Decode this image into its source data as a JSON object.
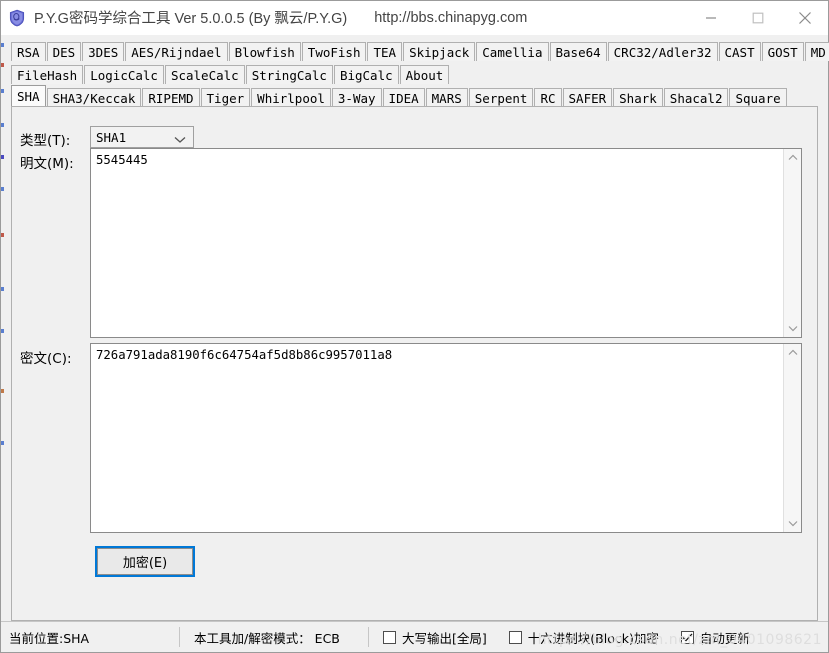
{
  "window": {
    "icon": "shield-app-icon",
    "title": "P.Y.G密码学综合工具 Ver 5.0.0.5 (By 飘云/P.Y.G)",
    "url": "http://bbs.chinapyg.com",
    "controls": {
      "minimize": "minimize-icon",
      "maximize": "maximize-icon",
      "close": "close-icon"
    }
  },
  "tabs": {
    "row1": [
      {
        "label": "RSA"
      },
      {
        "label": "DES"
      },
      {
        "label": "3DES"
      },
      {
        "label": "AES/Rijndael"
      },
      {
        "label": "Blowfish"
      },
      {
        "label": "TwoFish"
      },
      {
        "label": "TEA"
      },
      {
        "label": "Skipjack"
      },
      {
        "label": "Camellia"
      },
      {
        "label": "Base64"
      },
      {
        "label": "CRC32/Adler32"
      },
      {
        "label": "CAST"
      },
      {
        "label": "GOST"
      },
      {
        "label": "MD"
      }
    ],
    "row2": [
      {
        "label": "FileHash"
      },
      {
        "label": "LogicCalc"
      },
      {
        "label": "ScaleCalc"
      },
      {
        "label": "StringCalc"
      },
      {
        "label": "BigCalc"
      },
      {
        "label": "About"
      }
    ],
    "row3": [
      {
        "label": "SHA",
        "selected": true
      },
      {
        "label": "SHA3/Keccak"
      },
      {
        "label": "RIPEMD"
      },
      {
        "label": "Tiger"
      },
      {
        "label": "Whirlpool"
      },
      {
        "label": "3-Way"
      },
      {
        "label": "IDEA"
      },
      {
        "label": "MARS"
      },
      {
        "label": "Serpent"
      },
      {
        "label": "RC"
      },
      {
        "label": "SAFER"
      },
      {
        "label": "Shark"
      },
      {
        "label": "Shacal2"
      },
      {
        "label": "Square"
      }
    ]
  },
  "form": {
    "type_label": "类型(T):",
    "type_value": "SHA1",
    "type_chevron": "chevron-down-icon",
    "plain_label": "明文(M):",
    "plain_value": "5545445",
    "cipher_label": "密文(C):",
    "cipher_value": "726a791ada8190f6c64754af5d8b86c9957011a8",
    "encrypt_button": "加密(E)"
  },
  "status": {
    "position": "当前位置:SHA",
    "mode": "本工具加/解密模式： ECB",
    "upper_output": {
      "label": "大写输出[全局]",
      "checked": false
    },
    "hex_block": {
      "label": "十六进制块(Block)加密",
      "checked": false
    },
    "auto_update": {
      "label": "自动更新",
      "checked": true
    }
  },
  "watermark": "https://blog.csdn.net/zm_0401098621",
  "colors": {
    "accent": "#0078d7",
    "window_bg": "#f0f0f0",
    "border": "#b0b0b0",
    "text": "#000000",
    "title_text": "#444444"
  }
}
